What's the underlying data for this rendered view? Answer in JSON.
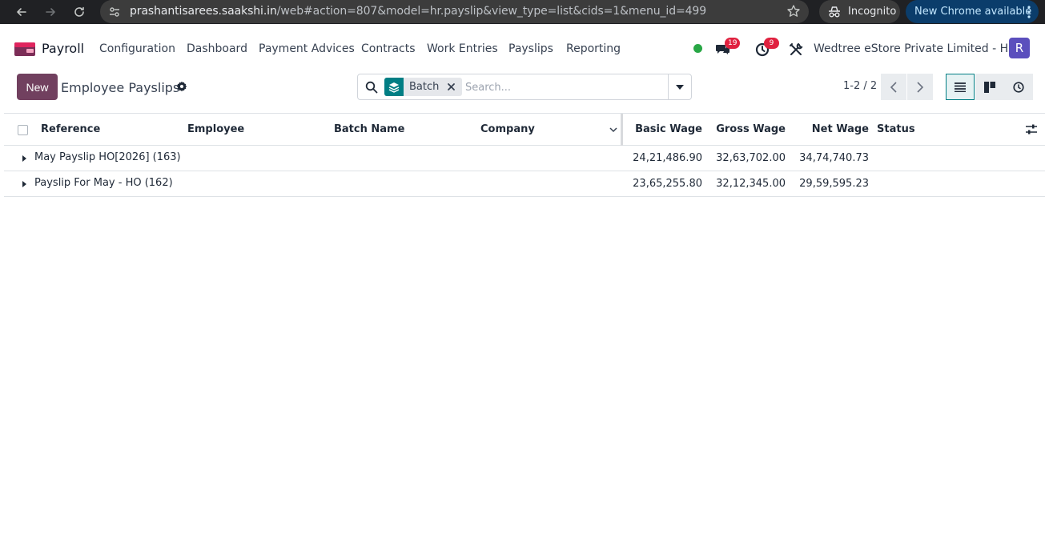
{
  "browser": {
    "url_host": "prashantisarees.saakshi.in",
    "url_path": "/web#action=807&model=hr.payslip&view_type=list&cids=1&menu_id=499",
    "incognito_label": "Incognito",
    "update_label": "New Chrome available"
  },
  "navbar": {
    "app_name": "Payroll",
    "menu": [
      "Configuration",
      "Dashboard",
      "Payment Advices",
      "Contracts",
      "Work Entries",
      "Payslips",
      "Reporting"
    ],
    "messages_count": "19",
    "activities_count": "9",
    "company": "Wedtree eStore Private Limited - HO",
    "avatar_initial": "R",
    "colors": {
      "presence": "#28a745",
      "badge": "#e0213f",
      "avatar": "#5b4fbd"
    }
  },
  "control_panel": {
    "new_label": "New",
    "title": "Employee Payslips",
    "facet_label": "Batch",
    "search_placeholder": "Search...",
    "pager": "1-2 / 2",
    "colors": {
      "primary": "#71405f",
      "facet": "#017e84"
    }
  },
  "table": {
    "columns": {
      "reference": "Reference",
      "employee": "Employee",
      "batch_name": "Batch Name",
      "company": "Company",
      "basic_wage": "Basic Wage",
      "gross_wage": "Gross Wage",
      "net_wage": "Net Wage",
      "status": "Status"
    },
    "groups": [
      {
        "label": "May Payslip HO[2026] (163)",
        "basic": "24,21,486.90",
        "gross": "32,63,702.00",
        "net": "34,74,740.73"
      },
      {
        "label": "Payslip For May - HO (162)",
        "basic": "23,65,255.80",
        "gross": "32,12,345.00",
        "net": "29,59,595.23"
      }
    ]
  }
}
